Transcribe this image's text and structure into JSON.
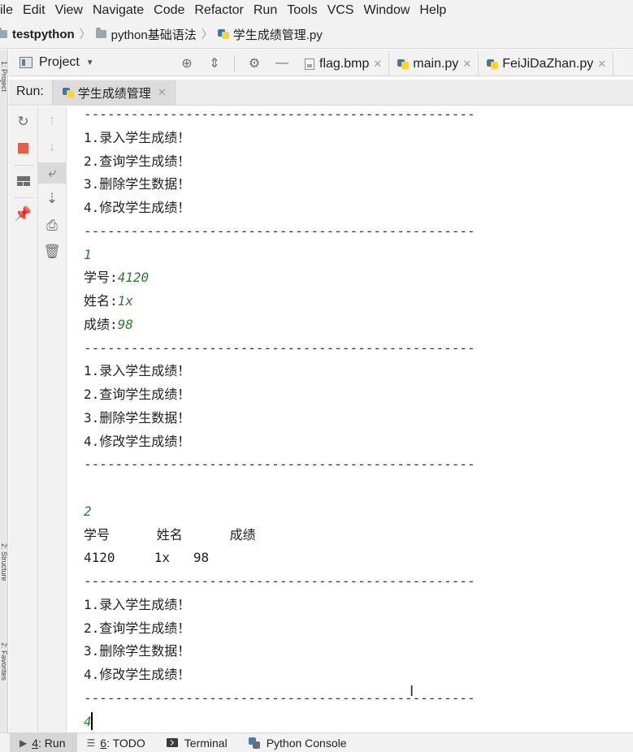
{
  "menu": [
    "ile",
    "Edit",
    "View",
    "Navigate",
    "Code",
    "Refactor",
    "Run",
    "Tools",
    "VCS",
    "Window",
    "Help"
  ],
  "breadcrumb": {
    "project": "testpython",
    "folder": "python基础语法",
    "file": "学生成绩管理.py"
  },
  "project_panel": {
    "title": "Project",
    "icons": [
      "crosshair-icon",
      "collapse-icon",
      "gear-icon",
      "minimize-icon"
    ]
  },
  "editor_tabs": [
    {
      "label": "flag.bmp",
      "icon": "bmp-file-icon"
    },
    {
      "label": "main.py",
      "icon": "python-file-icon"
    },
    {
      "label": "FeiJiDaZhan.py",
      "icon": "python-file-icon"
    }
  ],
  "run_panel": {
    "label": "Run:",
    "tab": "学生成绩管理"
  },
  "left_strip": {
    "tab_top": "1: Project",
    "tab_mid": "2: Structure",
    "tab_bottom": "2: Favorites"
  },
  "console_lines": [
    {
      "text": "--------------------------------------------------",
      "kind": "sep"
    },
    {
      "text": "1.录入学生成绩！",
      "kind": "out"
    },
    {
      "text": "2.查询学生成绩！",
      "kind": "out"
    },
    {
      "text": "3.删除学生数据！",
      "kind": "out"
    },
    {
      "text": "4.修改学生成绩！",
      "kind": "out"
    },
    {
      "text": "--------------------------------------------------",
      "kind": "sep"
    },
    {
      "text": "1",
      "kind": "input"
    },
    {
      "text": "学号:",
      "kind": "prompt",
      "value": "4120"
    },
    {
      "text": "姓名:",
      "kind": "prompt",
      "value": "1x"
    },
    {
      "text": "成绩:",
      "kind": "prompt",
      "value": "98"
    },
    {
      "text": "--------------------------------------------------",
      "kind": "sep"
    },
    {
      "text": "1.录入学生成绩！",
      "kind": "out"
    },
    {
      "text": "2.查询学生成绩！",
      "kind": "out"
    },
    {
      "text": "3.删除学生数据！",
      "kind": "out"
    },
    {
      "text": "4.修改学生成绩！",
      "kind": "out"
    },
    {
      "text": "--------------------------------------------------",
      "kind": "sep"
    },
    {
      "text": "",
      "kind": "blank"
    },
    {
      "text": "2",
      "kind": "input"
    },
    {
      "text": "学号      姓名      成绩",
      "kind": "out"
    },
    {
      "text": "4120     1x   98",
      "kind": "out"
    },
    {
      "text": "--------------------------------------------------",
      "kind": "sep"
    },
    {
      "text": "1.录入学生成绩！",
      "kind": "out"
    },
    {
      "text": "2.查询学生成绩！",
      "kind": "out"
    },
    {
      "text": "3.删除学生数据！",
      "kind": "out"
    },
    {
      "text": "4.修改学生成绩！",
      "kind": "out"
    },
    {
      "text": "--------------------------------------------------",
      "kind": "sep"
    },
    {
      "text": "4",
      "kind": "input"
    }
  ],
  "bottom_bar": [
    {
      "num": "4",
      "label": ": Run",
      "icon": "run-icon",
      "active": true
    },
    {
      "num": "6",
      "label": ": TODO",
      "icon": "todo-list-icon",
      "active": false
    },
    {
      "num": "",
      "label": "Terminal",
      "icon": "terminal-icon",
      "active": false
    },
    {
      "num": "",
      "label": "Python Console",
      "icon": "python-console-icon",
      "active": false
    }
  ]
}
